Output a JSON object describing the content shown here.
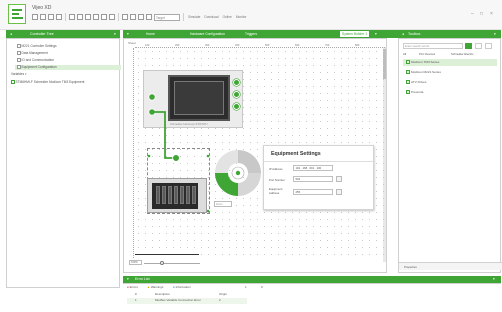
{
  "app": {
    "title": "Vijeo XD",
    "window_controls": [
      "–",
      "□",
      "×"
    ]
  },
  "toolbar": {
    "target_select": "Target",
    "simulate_label": "Simulate",
    "download_label": "Download",
    "online_label": "Online",
    "monitor_label": "Monitor"
  },
  "left_panel": {
    "header": "Controller Tree",
    "items": [
      {
        "label": "M221 Controller Settings",
        "selected": false
      },
      {
        "label": "Data Management",
        "selected": false
      },
      {
        "label": "IO and Communication",
        "selected": false
      },
      {
        "label": "Equipment Configuration",
        "selected": true
      },
      {
        "label": "Variables",
        "selected": false
      }
    ],
    "device_row": "STM6HMI-F Schneider Modicon TM3 Equipment"
  },
  "editor": {
    "tabs": [
      {
        "label": "Home",
        "active": false
      },
      {
        "label": "Hardware Configuration",
        "active": false
      },
      {
        "label": "Triggers",
        "active": false
      },
      {
        "label": "System Builder",
        "active": true
      }
    ],
    "tab_badge": "1",
    "sheet_label": "Sheet",
    "ruler_labels": [
      "100",
      "200",
      "300",
      "400",
      "500",
      "600",
      "700",
      "800"
    ],
    "hmi_caption": "Schneider Harmony STO/STU",
    "dial_placeholder": "Zoom",
    "zoom_value": "100%"
  },
  "settings_dialog": {
    "title": "Equipment Settings",
    "fields": [
      {
        "label": "IP Address",
        "value": "192 . 168 . 001 . 100"
      },
      {
        "label": "Port Number",
        "value": "502"
      },
      {
        "label": "Equipment Address",
        "value": "255"
      }
    ]
  },
  "right_panel": {
    "header": "Toolbox",
    "search_placeholder": "Enter search words",
    "filter_tabs": [
      "All",
      "PLC Devices",
      "Schneider Electric"
    ],
    "items": [
      {
        "label": "Modicon TM3 Series",
        "highlight": true
      },
      {
        "label": "Modicon M221 Series",
        "highlight": false
      },
      {
        "label": "ATV Drives",
        "highlight": false
      },
      {
        "label": "Preventa",
        "highlight": false
      }
    ],
    "footer": "Properties"
  },
  "bottom_panel": {
    "header": "Error List",
    "toolbar": [
      "Errors",
      "Warnings",
      "Information"
    ],
    "counts": [
      "1",
      "0"
    ],
    "columns": [
      "#",
      "Description",
      "Origin"
    ],
    "rows": [
      {
        "num": "1",
        "description": "Modbus Variable Connection Error",
        "origin": "2"
      }
    ]
  },
  "colors": {
    "accent": "#3fa535",
    "selected_bg": "#dcefd7",
    "dark_screen": "#2c2c2c"
  }
}
